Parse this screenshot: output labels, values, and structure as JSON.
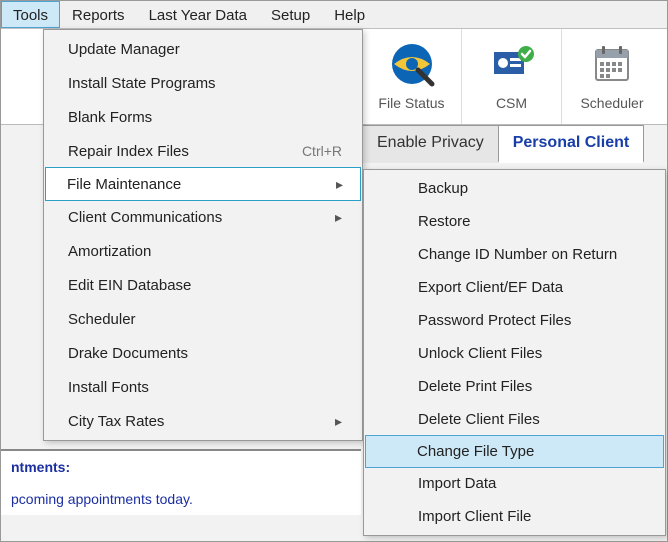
{
  "menubar": {
    "items": [
      "Tools",
      "Reports",
      "Last Year Data",
      "Setup",
      "Help"
    ],
    "active_index": 0
  },
  "toolbar": {
    "buttons": [
      {
        "label": "File Status",
        "icon": "file-status-icon"
      },
      {
        "label": "CSM",
        "icon": "csm-icon"
      },
      {
        "label": "Scheduler",
        "icon": "scheduler-icon"
      }
    ]
  },
  "tabs": {
    "privacy_label": "Enable Privacy",
    "active_label": "Personal Client"
  },
  "tools_menu": {
    "items": [
      {
        "label": "Update Manager"
      },
      {
        "label": "Install State Programs"
      },
      {
        "label": "Blank Forms"
      },
      {
        "label": "Repair Index Files",
        "shortcut": "Ctrl+R"
      },
      {
        "label": "File Maintenance",
        "submenu": true,
        "highlight": true
      },
      {
        "label": "Client Communications",
        "submenu": true
      },
      {
        "label": "Amortization"
      },
      {
        "label": "Edit EIN Database"
      },
      {
        "label": "Scheduler"
      },
      {
        "label": "Drake Documents"
      },
      {
        "label": "Install Fonts"
      },
      {
        "label": "City Tax Rates",
        "submenu": true
      }
    ]
  },
  "file_maintenance_submenu": {
    "items": [
      {
        "label": "Backup"
      },
      {
        "label": "Restore"
      },
      {
        "label": "Change ID Number on Return"
      },
      {
        "label": "Export Client/EF Data"
      },
      {
        "label": "Password Protect Files"
      },
      {
        "label": "Unlock Client Files"
      },
      {
        "label": "Delete Print Files"
      },
      {
        "label": "Delete Client Files"
      },
      {
        "label": "Change File Type",
        "highlight": true
      },
      {
        "label": "Import Data"
      },
      {
        "label": "Import Client File"
      }
    ]
  },
  "appointments": {
    "header": "ntments:",
    "message": "pcoming appointments today."
  }
}
